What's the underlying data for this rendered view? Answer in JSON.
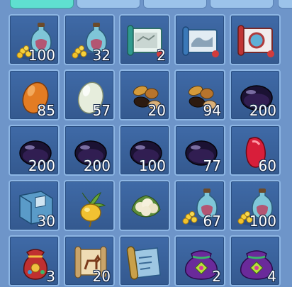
{
  "tabs": [
    {
      "name": "tab-1",
      "active": true
    },
    {
      "name": "tab-2",
      "active": false
    },
    {
      "name": "tab-3",
      "active": false
    },
    {
      "name": "tab-4",
      "active": false
    },
    {
      "name": "tab-5",
      "active": false
    }
  ],
  "inventory": {
    "slots": [
      {
        "icon": "coins-potion-icon",
        "quantity": "100"
      },
      {
        "icon": "coins-potion-icon",
        "quantity": "32"
      },
      {
        "icon": "scroll-map-white-icon",
        "quantity": "2"
      },
      {
        "icon": "scroll-map-blue-icon",
        "quantity": ""
      },
      {
        "icon": "scroll-map-red-icon",
        "quantity": ""
      },
      {
        "icon": "orange-egg-icon",
        "quantity": "85"
      },
      {
        "icon": "white-egg-icon",
        "quantity": "57"
      },
      {
        "icon": "brown-beans-icon",
        "quantity": "20"
      },
      {
        "icon": "brown-beans-icon",
        "quantity": "94"
      },
      {
        "icon": "dark-gem-icon",
        "quantity": "200"
      },
      {
        "icon": "dark-gem-icon",
        "quantity": "200"
      },
      {
        "icon": "dark-gem-icon",
        "quantity": "200"
      },
      {
        "icon": "dark-gem-icon",
        "quantity": "100"
      },
      {
        "icon": "dark-gem-icon",
        "quantity": "77"
      },
      {
        "icon": "red-gem-icon",
        "quantity": "60"
      },
      {
        "icon": "blue-book-icon",
        "quantity": "30"
      },
      {
        "icon": "golden-turnip-icon",
        "quantity": ""
      },
      {
        "icon": "cauliflower-icon",
        "quantity": ""
      },
      {
        "icon": "coins-potion-icon",
        "quantity": "67"
      },
      {
        "icon": "coins-potion-icon",
        "quantity": "100"
      },
      {
        "icon": "treasure-bag-icon",
        "quantity": "3"
      },
      {
        "icon": "horse-scroll-icon",
        "quantity": "20"
      },
      {
        "icon": "blue-scroll-icon",
        "quantity": ""
      },
      {
        "icon": "purple-pouch-icon",
        "quantity": "2"
      },
      {
        "icon": "purple-pouch-icon",
        "quantity": "4"
      }
    ]
  },
  "colors": {
    "background": "#6e95c9",
    "slot_bg": "#3f6aa7",
    "slot_border": "#8db6e4",
    "active_tab": "#5fe0d0",
    "inactive_tab": "#9cc3ea"
  }
}
